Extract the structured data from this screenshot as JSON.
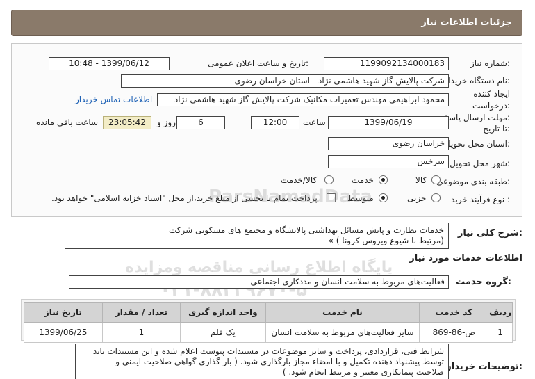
{
  "header": {
    "title": "جزئیات اطلاعات نیاز"
  },
  "fields": {
    "need_number_label": "شماره نیاز:",
    "need_number": "1199092134000183",
    "announce_label": "تاریخ و ساعت اعلان عمومی:",
    "announce_value": "1399/06/12 - 10:48",
    "buyer_label": "نام دستگاه خریدار:",
    "buyer_value": "شرکت پالایش گاز شهید هاشمی نژاد - استان خراسان رضوی",
    "creator_label": "ایجاد کننده درخواست:",
    "creator_value": "محمود ابراهیمی مهندس تعمیرات مکانیک شرکت پالایش گاز شهید هاشمی نژاد",
    "contact_link": "اطلاعات تماس خریدار",
    "deadline_label": "مهلت ارسال پاسخ: تا تاریخ:",
    "deadline_date": "1399/06/19",
    "time_label": "ساعت",
    "deadline_time": "12:00",
    "days_value": "6",
    "days_label": "روز و",
    "remaining_time": "23:05:42",
    "remaining_label": "ساعت باقی مانده",
    "province_label": "استان محل تحویل:",
    "province_value": "خراسان رضوی",
    "city_label": "شهر محل تحویل:",
    "city_value": "سرخس",
    "category_label": "طبقه بندی موضوعی:",
    "category_options": [
      "کالا",
      "خدمت",
      "کالا/خدمت"
    ],
    "category_selected": "خدمت",
    "process_label": "نوع فرآیند خرید :",
    "process_options": [
      "جزیی",
      "متوسط"
    ],
    "process_selected": "متوسط",
    "payment_note": "پرداخت تمام یا بخشی از مبلغ خرید،از محل \"اسناد خزانه اسلامی\" خواهد بود."
  },
  "summary": {
    "label": "شرح کلی نیاز:",
    "line1": "خدمات  نظارت و پایش مسائل بهداشتی پالایشگاه و مجتمع های مسکونی شرکت",
    "line2": "(مرتبط با شیوع ویروس کرونا ) »"
  },
  "services_title": "اطلاعات خدمات مورد نیاز",
  "service_group": {
    "label": "گروه خدمت:",
    "value": "فعالیت‌های مربوط به سلامت انسان و مددکاری اجتماعی"
  },
  "table": {
    "headers": [
      "ردیف",
      "کد خدمت",
      "نام خدمت",
      "واحد اندازه گیری",
      "تعداد / مقدار",
      "تاریخ نیاز"
    ],
    "rows": [
      [
        "1",
        "ص-86-869",
        "سایر فعالیت‌های مربوط به سلامت انسان",
        "یک قلم",
        "1",
        "1399/06/25"
      ]
    ]
  },
  "buyer_notes": {
    "label": "توضیحات خریدار:",
    "line1": "شرایط فنی، قراردادی، پرداخت و سایر موضوعات در مستندات پیوست اعلام شده و این مستندات باید",
    "line2": "توسط پیشنهاد دهنده تکمیل و با امضاء مجاز بارگذاری شود. ( بار گذاری گواهی صلاحیت ایمنی و",
    "line3": "صلاحیت پیمانکاری معتبر و مرتبط انجام شود. )"
  },
  "watermark": {
    "brand": "ParsNamadData",
    "line1": "پایگاه اطلاع رسانی مناقصه ومزایده",
    "phone": "۰۲۱-۸۸۳۴۹۶۷۰-۵"
  }
}
